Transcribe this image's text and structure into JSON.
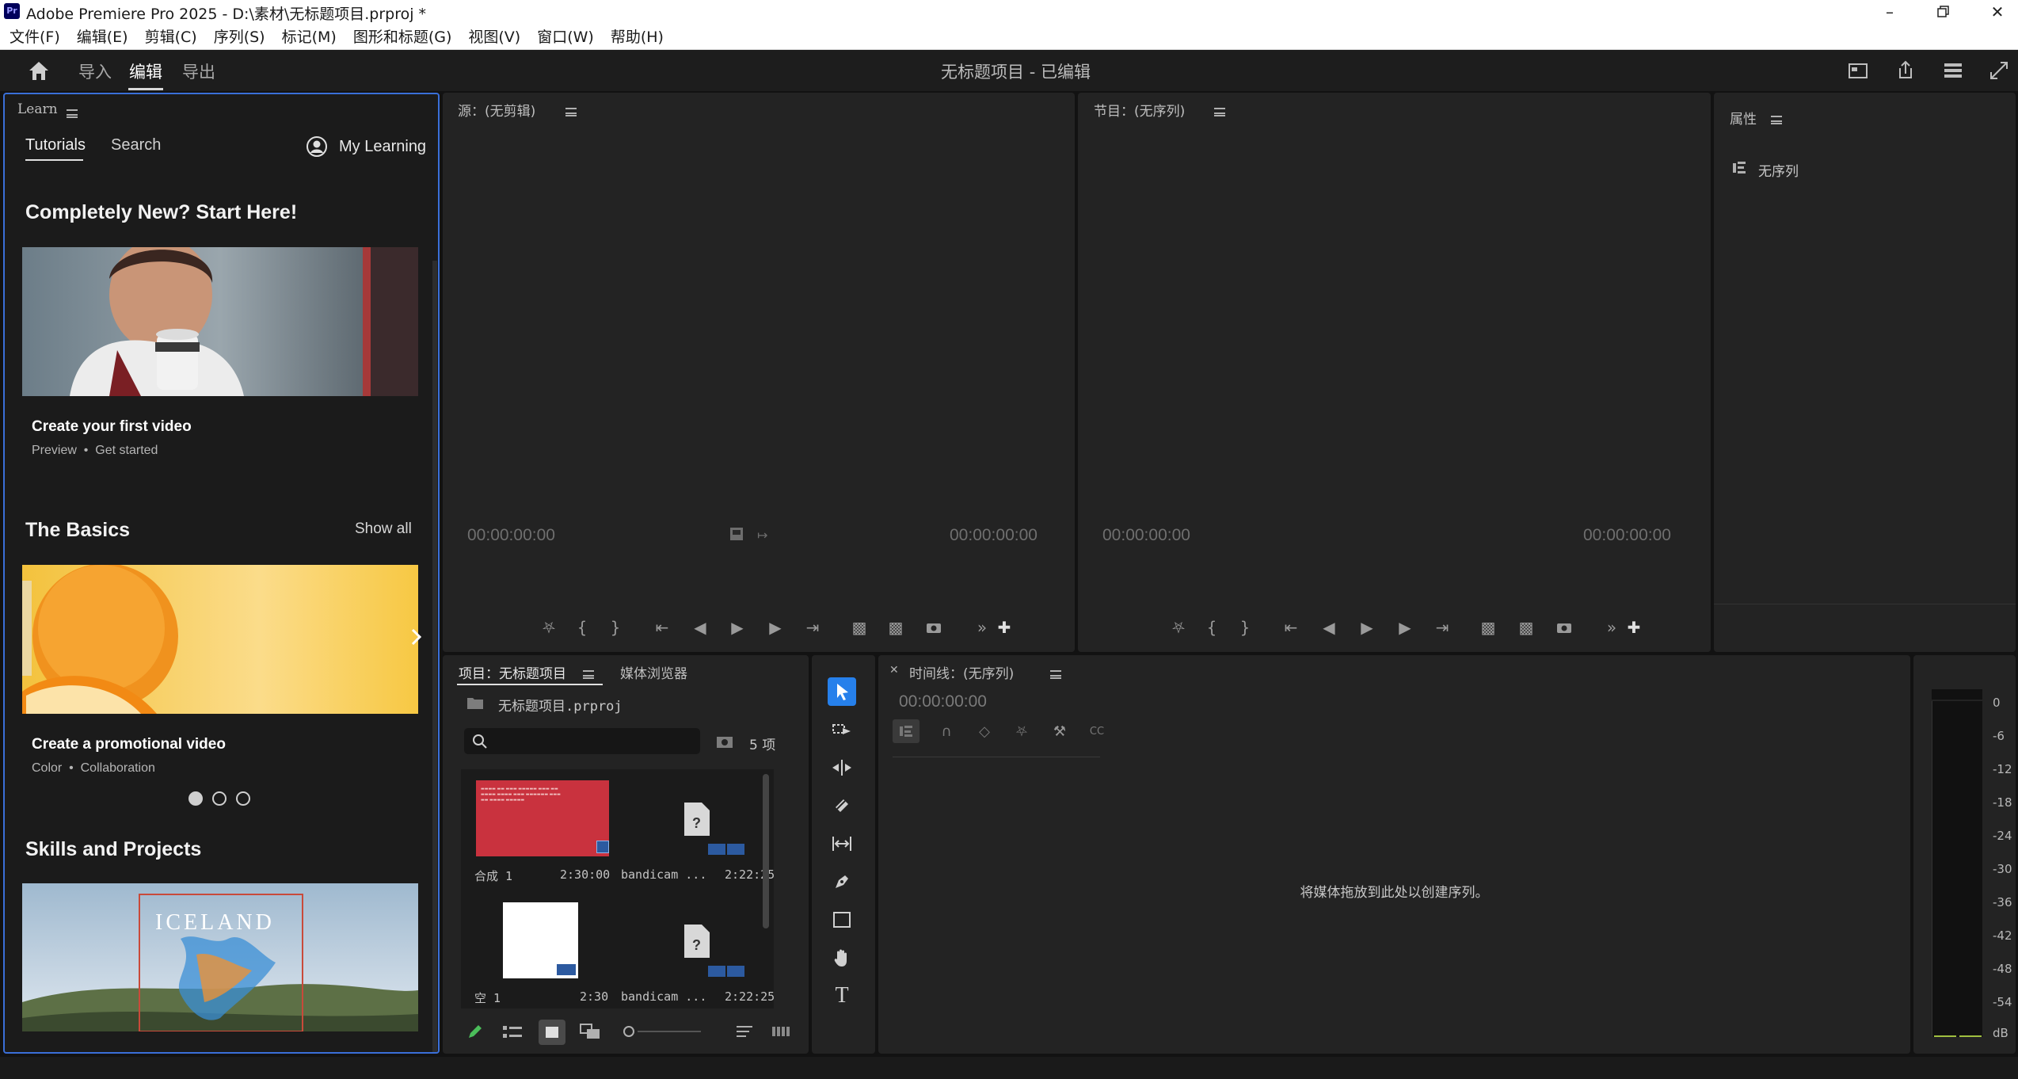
{
  "titlebar": {
    "logo": "Pr",
    "title": "Adobe Premiere Pro 2025 - D:\\素材\\无标题项目.prproj *",
    "controls": [
      "minimize-icon",
      "restore-icon",
      "close-icon"
    ]
  },
  "menu": [
    "文件(F)",
    "编辑(E)",
    "剪辑(C)",
    "序列(S)",
    "标记(M)",
    "图形和标题(G)",
    "视图(V)",
    "窗口(W)",
    "帮助(H)"
  ],
  "header": {
    "tabs": [
      "导入",
      "编辑",
      "导出"
    ],
    "active_tab": "编辑",
    "project_title": "无标题项目 - 已编辑"
  },
  "learn": {
    "panel_title": "Learn",
    "tabs": [
      "Tutorials",
      "Search"
    ],
    "my_learning": "My Learning",
    "section1_title": "Completely New? Start Here!",
    "card1": {
      "title": "Create your first video",
      "meta1": "Preview",
      "meta2": "Get started"
    },
    "section2_title": "The Basics",
    "show_all": "Show all",
    "card2": {
      "title": "Create a promotional video",
      "meta1": "Color",
      "meta2": "Collaboration"
    },
    "section3_title": "Skills and Projects",
    "card3_overlay": "ICELAND",
    "carousel_pages": 3,
    "carousel_active": 1
  },
  "source_monitor": {
    "title": "源：(无剪辑)",
    "tc_left": "00:00:00:00",
    "tc_right": "00:00:00:00"
  },
  "program_monitor": {
    "title": "节目：(无序列)",
    "tc_left": "00:00:00:00",
    "tc_right": "00:00:00:00"
  },
  "properties": {
    "title": "属性",
    "item": "无序列"
  },
  "project": {
    "tab_active": "项目：无标题项目",
    "tab_other": "媒体浏览器",
    "file": "无标题项目.prproj",
    "search_placeholder": "",
    "count": "5 项",
    "items": [
      {
        "name": "合成 1",
        "duration": "2:30:00"
      },
      {
        "name": "bandicam ...",
        "duration": "2:22:25"
      },
      {
        "name": "空 1",
        "duration": "2:30"
      },
      {
        "name": "bandicam ...",
        "duration": "2:22:25"
      }
    ]
  },
  "timeline": {
    "title": "时间线：(无序列)",
    "tc": "00:00:00:00",
    "empty_msg": "将媒体拖放到此处以创建序列。"
  },
  "meter": {
    "labels": [
      "0",
      "-6",
      "-12",
      "-18",
      "-24",
      "-30",
      "-36",
      "-42",
      "-48",
      "-54",
      "dB"
    ]
  },
  "colors": {
    "accent": "#2680eb",
    "panel_bg": "#232323",
    "app_bg": "#121212",
    "learn_border": "#3a6fd8"
  }
}
